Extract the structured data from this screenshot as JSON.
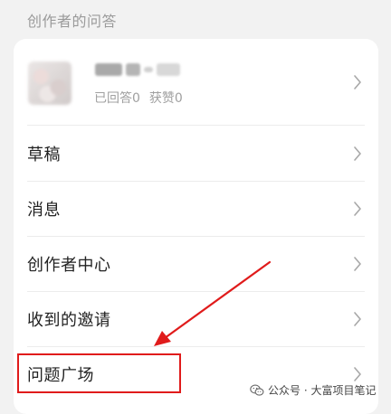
{
  "section": {
    "title": "创作者的问答"
  },
  "profile": {
    "name_label": "",
    "stats": [
      "已回答0",
      "获赞0"
    ]
  },
  "menu": {
    "items": [
      {
        "label": "草稿"
      },
      {
        "label": "消息"
      },
      {
        "label": "创作者中心"
      },
      {
        "label": "收到的邀请"
      },
      {
        "label": "问题广场"
      }
    ]
  },
  "annotation": {
    "highlight_color": "#e01b1b",
    "highlighted_item": "问题广场"
  },
  "watermark": {
    "text": "公众号 · 大富项目笔记"
  },
  "colors": {
    "background": "#f2f2f2",
    "card": "#ffffff",
    "text_primary": "#222222",
    "text_secondary": "#a0a0a0",
    "chevron": "#a8a8a8"
  },
  "icons": {
    "row_trailing": "chevron-right-icon",
    "watermark": "wechat-icon"
  }
}
